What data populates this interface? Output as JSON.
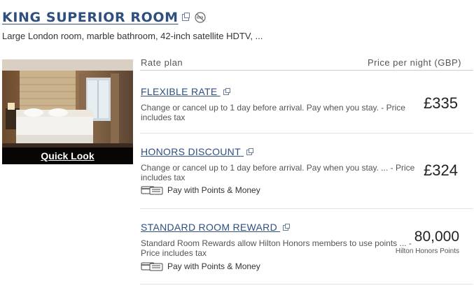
{
  "room": {
    "title": "KING SUPERIOR ROOM",
    "description": "Large London room, marble bathroom, 42-inch satellite HDTV, ...",
    "quick_look": "Quick Look"
  },
  "table": {
    "col_rate": "Rate plan",
    "col_price": "Price per night (GBP)"
  },
  "rates": [
    {
      "name": "FLEXIBLE RATE",
      "description": "Change or cancel up to 1 day before arrival. Pay when you stay. - Price includes tax",
      "price": "£335"
    },
    {
      "name": "HONORS DISCOUNT",
      "description": "Change or cancel up to 1 day before arrival. Pay when you stay. ... - Price includes tax",
      "pay_option": "Pay with Points & Money",
      "price": "£324"
    },
    {
      "name": "STANDARD ROOM REWARD",
      "description": "Standard Room Rewards allow Hilton Honors members to use points ... - Price includes tax",
      "pay_option": "Pay with Points & Money",
      "price": "80,000",
      "price_unit": "Hilton Honors Points"
    }
  ],
  "colors": {
    "link": "#2f4f7f",
    "text": "#333333"
  },
  "icons": [
    "external-link-icon",
    "no-smoking-icon",
    "points-money-icon"
  ]
}
